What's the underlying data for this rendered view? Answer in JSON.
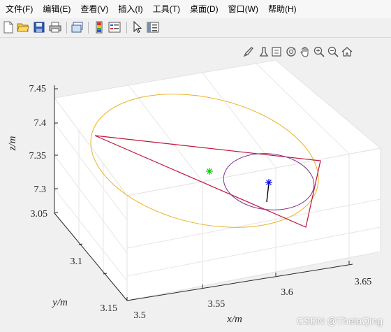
{
  "menu": [
    "文件(F)",
    "编辑(E)",
    "查看(V)",
    "插入(I)",
    "工具(T)",
    "桌面(D)",
    "窗口(W)",
    "帮助(H)"
  ],
  "toolbar": [
    "new-file-icon",
    "open-folder-icon",
    "save-icon",
    "print-icon",
    "link-plot-icon",
    "colorbar-icon",
    "legend-icon",
    "pointer-icon",
    "property-inspector-icon"
  ],
  "axes_toolbar": [
    "brush-icon",
    "data-cursor-icon",
    "zoom-box-icon",
    "rotate-3d-icon",
    "pan-icon",
    "zoom-in-icon",
    "zoom-out-icon",
    "home-icon"
  ],
  "plot": {
    "z_ticks": [
      "7.45",
      "7.4",
      "7.35",
      "7.3"
    ],
    "y_ticks": [
      "3.05",
      "3.1",
      "3.15"
    ],
    "x_ticks": [
      "3.5",
      "3.55",
      "3.6",
      "3.65"
    ],
    "xlabel": "x/m",
    "ylabel": "y/m",
    "zlabel": "z/m",
    "colors": {
      "ellipse": "#edb120",
      "triangle": "#c0143c",
      "circle": "#7e2f8e",
      "center_marker": "#00cc00",
      "point_marker": "#0000ff",
      "stem": "#000000"
    }
  },
  "watermark": "CSDN @ThetaQing"
}
